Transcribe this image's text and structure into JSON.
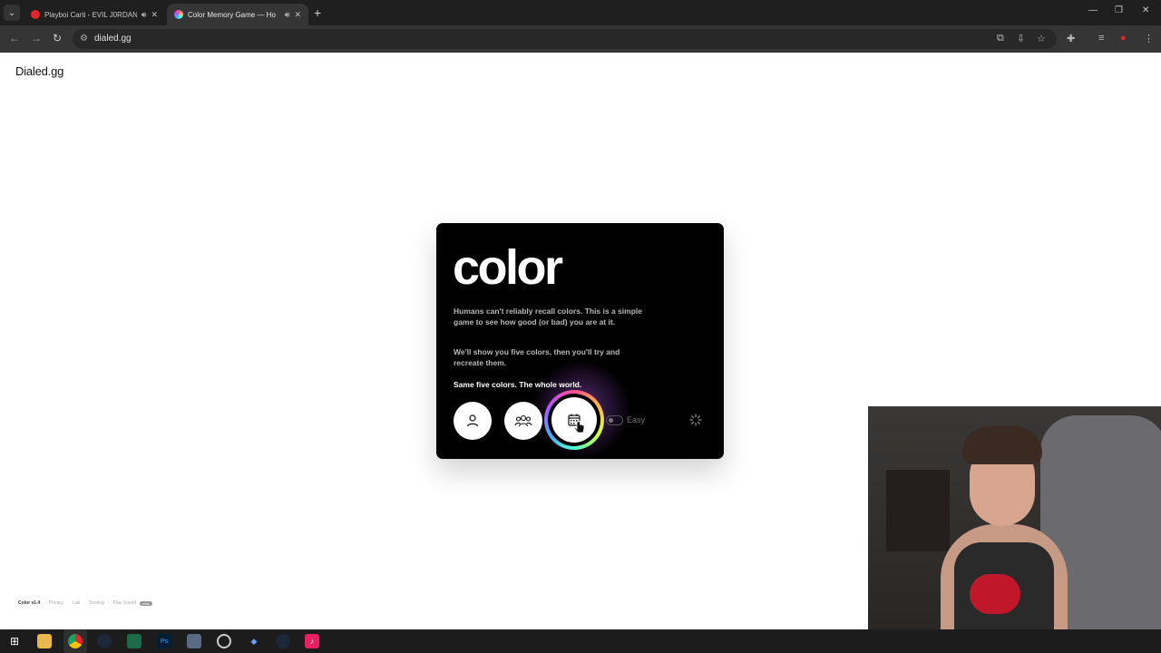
{
  "browser": {
    "tabs": [
      {
        "title": "Playboi Carti - EVIL J0RDAN",
        "favicon_color": "#e0262b"
      },
      {
        "title": "Color Memory Game — Ho",
        "favicon_color": "#a55cff"
      }
    ],
    "url": "dialed.gg"
  },
  "page": {
    "logo": "Dialed.gg",
    "card": {
      "title": "color",
      "paragraph1": "Humans can't reliably recall colors. This is a simple game to see how good (or bad) you are at it.",
      "paragraph2": "We'll show you five colors, then you'll try and recreate them.",
      "tagline": "Same five colors. The whole world.",
      "difficulty_label": "Easy"
    },
    "footer": {
      "version": "Color v1.4",
      "links": [
        "Privacy",
        "Lab",
        "Scoring",
        "Play Sound"
      ],
      "badge": "new"
    }
  },
  "colors": {
    "card_bg": "#000000",
    "ring_gradient": [
      "#ff4d8d",
      "#ffb84d",
      "#d6ff4d",
      "#4dffd0",
      "#4da6ff",
      "#b84dff"
    ]
  }
}
